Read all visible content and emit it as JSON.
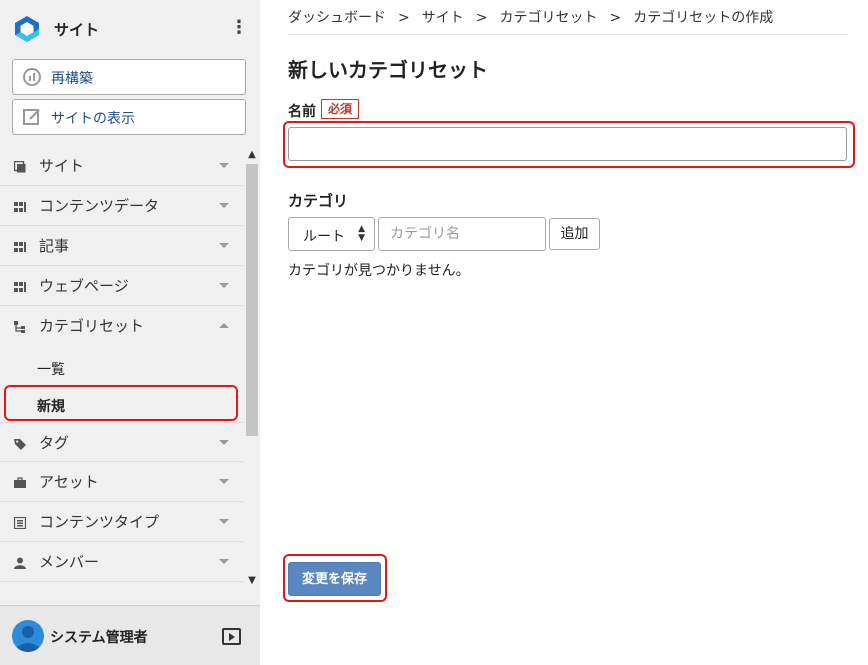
{
  "sidebar": {
    "brand_name": "サイト",
    "rebuild_label": "再構築",
    "view_site_label": "サイトの表示",
    "items": [
      {
        "label": "サイト",
        "icon": "window-icon"
      },
      {
        "label": "コンテンツデータ",
        "icon": "grid-icon"
      },
      {
        "label": "記事",
        "icon": "grid-icon"
      },
      {
        "label": "ウェブページ",
        "icon": "grid-icon"
      },
      {
        "label": "カテゴリセット",
        "icon": "tree-icon"
      },
      {
        "label": "タグ",
        "icon": "tag-icon"
      },
      {
        "label": "アセット",
        "icon": "briefcase-icon"
      },
      {
        "label": "コンテンツタイプ",
        "icon": "content-type-icon"
      },
      {
        "label": "メンバー",
        "icon": "person-icon"
      }
    ],
    "sub_items": [
      {
        "label": "一覧"
      },
      {
        "label": "新規"
      }
    ],
    "user_name": "システム管理者"
  },
  "breadcrumb": {
    "items": [
      "ダッシュボード",
      "サイト",
      "カテゴリセット",
      "カテゴリセットの作成"
    ],
    "separator": ">"
  },
  "main": {
    "title": "新しいカテゴリセット",
    "name_label": "名前",
    "required_badge": "必須",
    "name_value": "",
    "category_label": "カテゴリ",
    "root_select": "ルート",
    "category_placeholder": "カテゴリ名",
    "add_label": "追加",
    "empty_message": "カテゴリが見つかりません。",
    "save_label": "変更を保存"
  },
  "colors": {
    "accent": "#5b87c0",
    "highlight": "#e01818",
    "required": "#c0392b",
    "link": "#1f4d8c"
  }
}
